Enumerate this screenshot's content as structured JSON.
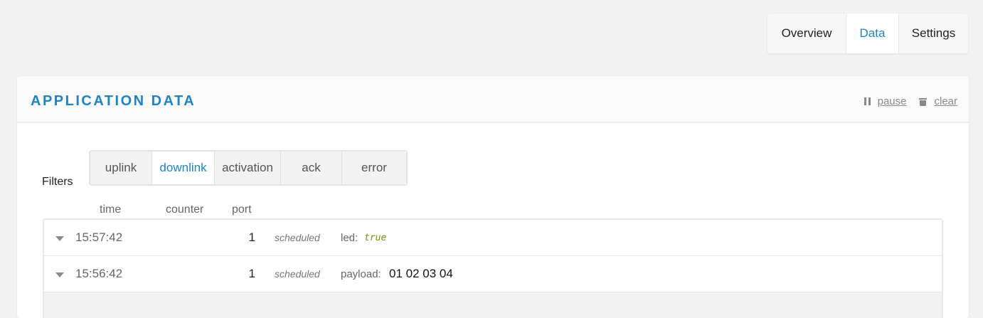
{
  "nav": {
    "tabs": [
      {
        "label": "Overview",
        "active": false
      },
      {
        "label": "Data",
        "active": true
      },
      {
        "label": "Settings",
        "active": false
      }
    ]
  },
  "card": {
    "title": "APPLICATION DATA",
    "actions": {
      "pause_label": "pause",
      "clear_label": "clear",
      "pause_icon": "pause-icon",
      "clear_icon": "trash-icon"
    }
  },
  "filters": {
    "label": "Filters",
    "options": [
      {
        "label": "uplink",
        "active": false
      },
      {
        "label": "downlink",
        "active": true
      },
      {
        "label": "activation",
        "active": false
      },
      {
        "label": "ack",
        "active": false
      },
      {
        "label": "error",
        "active": false
      }
    ]
  },
  "table": {
    "columns": [
      "time",
      "counter",
      "port"
    ],
    "rows": [
      {
        "time": "15:57:42",
        "counter": "",
        "port": "1",
        "status": "scheduled",
        "field_key": "led:",
        "field_value": "true"
      },
      {
        "time": "15:56:42",
        "counter": "",
        "port": "1",
        "status": "scheduled",
        "field_key": "payload:",
        "field_value": "01 02 03 04"
      }
    ]
  },
  "colors": {
    "accent": "#1d84c6",
    "code_value": "#7a8a1c",
    "background": "#f2f2f2"
  }
}
